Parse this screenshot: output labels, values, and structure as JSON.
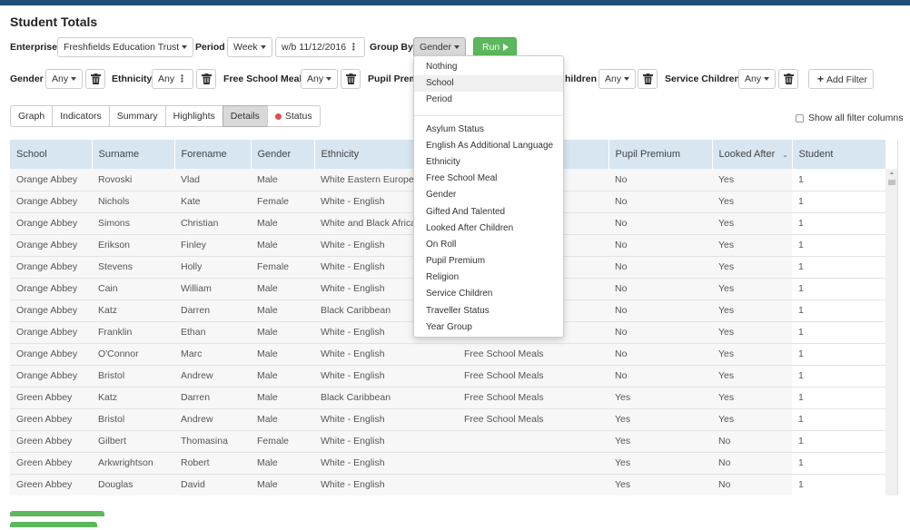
{
  "page": {
    "title": "Student Totals"
  },
  "filters_row1": {
    "enterprise_label": "Enterprise",
    "enterprise_value": "Freshfields Education Trust",
    "period_label": "Period",
    "period_value": "Week",
    "week_value": "w/b 11/12/2016",
    "groupby_label": "Group By",
    "groupby_value": "Gender",
    "run_label": "Run"
  },
  "filters_row2": {
    "gender_label": "Gender",
    "gender_value": "Any",
    "ethnicity_label": "Ethnicity",
    "ethnicity_value": "Any",
    "fsm_label": "Free School Meal",
    "fsm_value": "Any",
    "pupil_label_partial": "Pupil Prem",
    "lac_label_partial": "hildren",
    "lac_value": "Any",
    "service_label": "Service Children",
    "service_value": "Any",
    "add_filter_label": "Add Filter"
  },
  "tabs": [
    {
      "label": "Graph",
      "active": false
    },
    {
      "label": "Indicators",
      "active": false
    },
    {
      "label": "Summary",
      "active": false
    },
    {
      "label": "Highlights",
      "active": false
    },
    {
      "label": "Details",
      "active": true
    },
    {
      "label": "Status",
      "active": false,
      "status_dot_color": "#d9534f"
    }
  ],
  "show_all_label": "Show all filter columns",
  "table": {
    "columns": [
      "School",
      "Surname",
      "Forename",
      "Gender",
      "Ethnicity",
      "",
      "Pupil Premium",
      "Looked After",
      "Student"
    ],
    "rows": [
      [
        "Orange Abbey",
        "Rovoski",
        "Vlad",
        "Male",
        "White Eastern European",
        "",
        "No",
        "Yes",
        "1"
      ],
      [
        "Orange Abbey",
        "Nichols",
        "Kate",
        "Female",
        "White - English",
        "",
        "No",
        "Yes",
        "1"
      ],
      [
        "Orange Abbey",
        "Simons",
        "Christian",
        "Male",
        "White and Black African",
        "",
        "No",
        "Yes",
        "1"
      ],
      [
        "Orange Abbey",
        "Erikson",
        "Finley",
        "Male",
        "White - English",
        "",
        "No",
        "Yes",
        "1"
      ],
      [
        "Orange Abbey",
        "Stevens",
        "Holly",
        "Female",
        "White - English",
        "",
        "No",
        "Yes",
        "1"
      ],
      [
        "Orange Abbey",
        "Cain",
        "William",
        "Male",
        "White - English",
        "",
        "No",
        "Yes",
        "1"
      ],
      [
        "Orange Abbey",
        "Katz",
        "Darren",
        "Male",
        "Black Caribbean",
        "",
        "No",
        "Yes",
        "1"
      ],
      [
        "Orange Abbey",
        "Franklin",
        "Ethan",
        "Male",
        "White - English",
        "",
        "No",
        "Yes",
        "1"
      ],
      [
        "Orange Abbey",
        "O'Connor",
        "Marc",
        "Male",
        "White - English",
        "Free School Meals",
        "No",
        "Yes",
        "1"
      ],
      [
        "Orange Abbey",
        "Bristol",
        "Andrew",
        "Male",
        "White - English",
        "Free School Meals",
        "No",
        "Yes",
        "1"
      ],
      [
        "Green Abbey",
        "Katz",
        "Darren",
        "Male",
        "Black Caribbean",
        "Free School Meals",
        "Yes",
        "Yes",
        "1"
      ],
      [
        "Green Abbey",
        "Bristol",
        "Andrew",
        "Male",
        "White - English",
        "Free School Meals",
        "Yes",
        "Yes",
        "1"
      ],
      [
        "Green Abbey",
        "Gilbert",
        "Thomasina",
        "Female",
        "White - English",
        "",
        "Yes",
        "No",
        "1"
      ],
      [
        "Green Abbey",
        "Arkwrightson",
        "Robert",
        "Male",
        "White - English",
        "",
        "Yes",
        "No",
        "1"
      ],
      [
        "Green Abbey",
        "Douglas",
        "David",
        "Male",
        "White - English",
        "",
        "Yes",
        "No",
        "1"
      ]
    ]
  },
  "groupby_dropdown": {
    "group1": [
      "Nothing",
      "School",
      "Period"
    ],
    "highlighted": "School",
    "group2": [
      "Asylum Status",
      "English As Additional Language",
      "Ethnicity",
      "Free School Meal",
      "Gender",
      "Gifted And Talented",
      "Looked After Children",
      "On Roll",
      "Pupil Premium",
      "Religion",
      "Service Children",
      "Traveller Status",
      "Year Group"
    ]
  }
}
